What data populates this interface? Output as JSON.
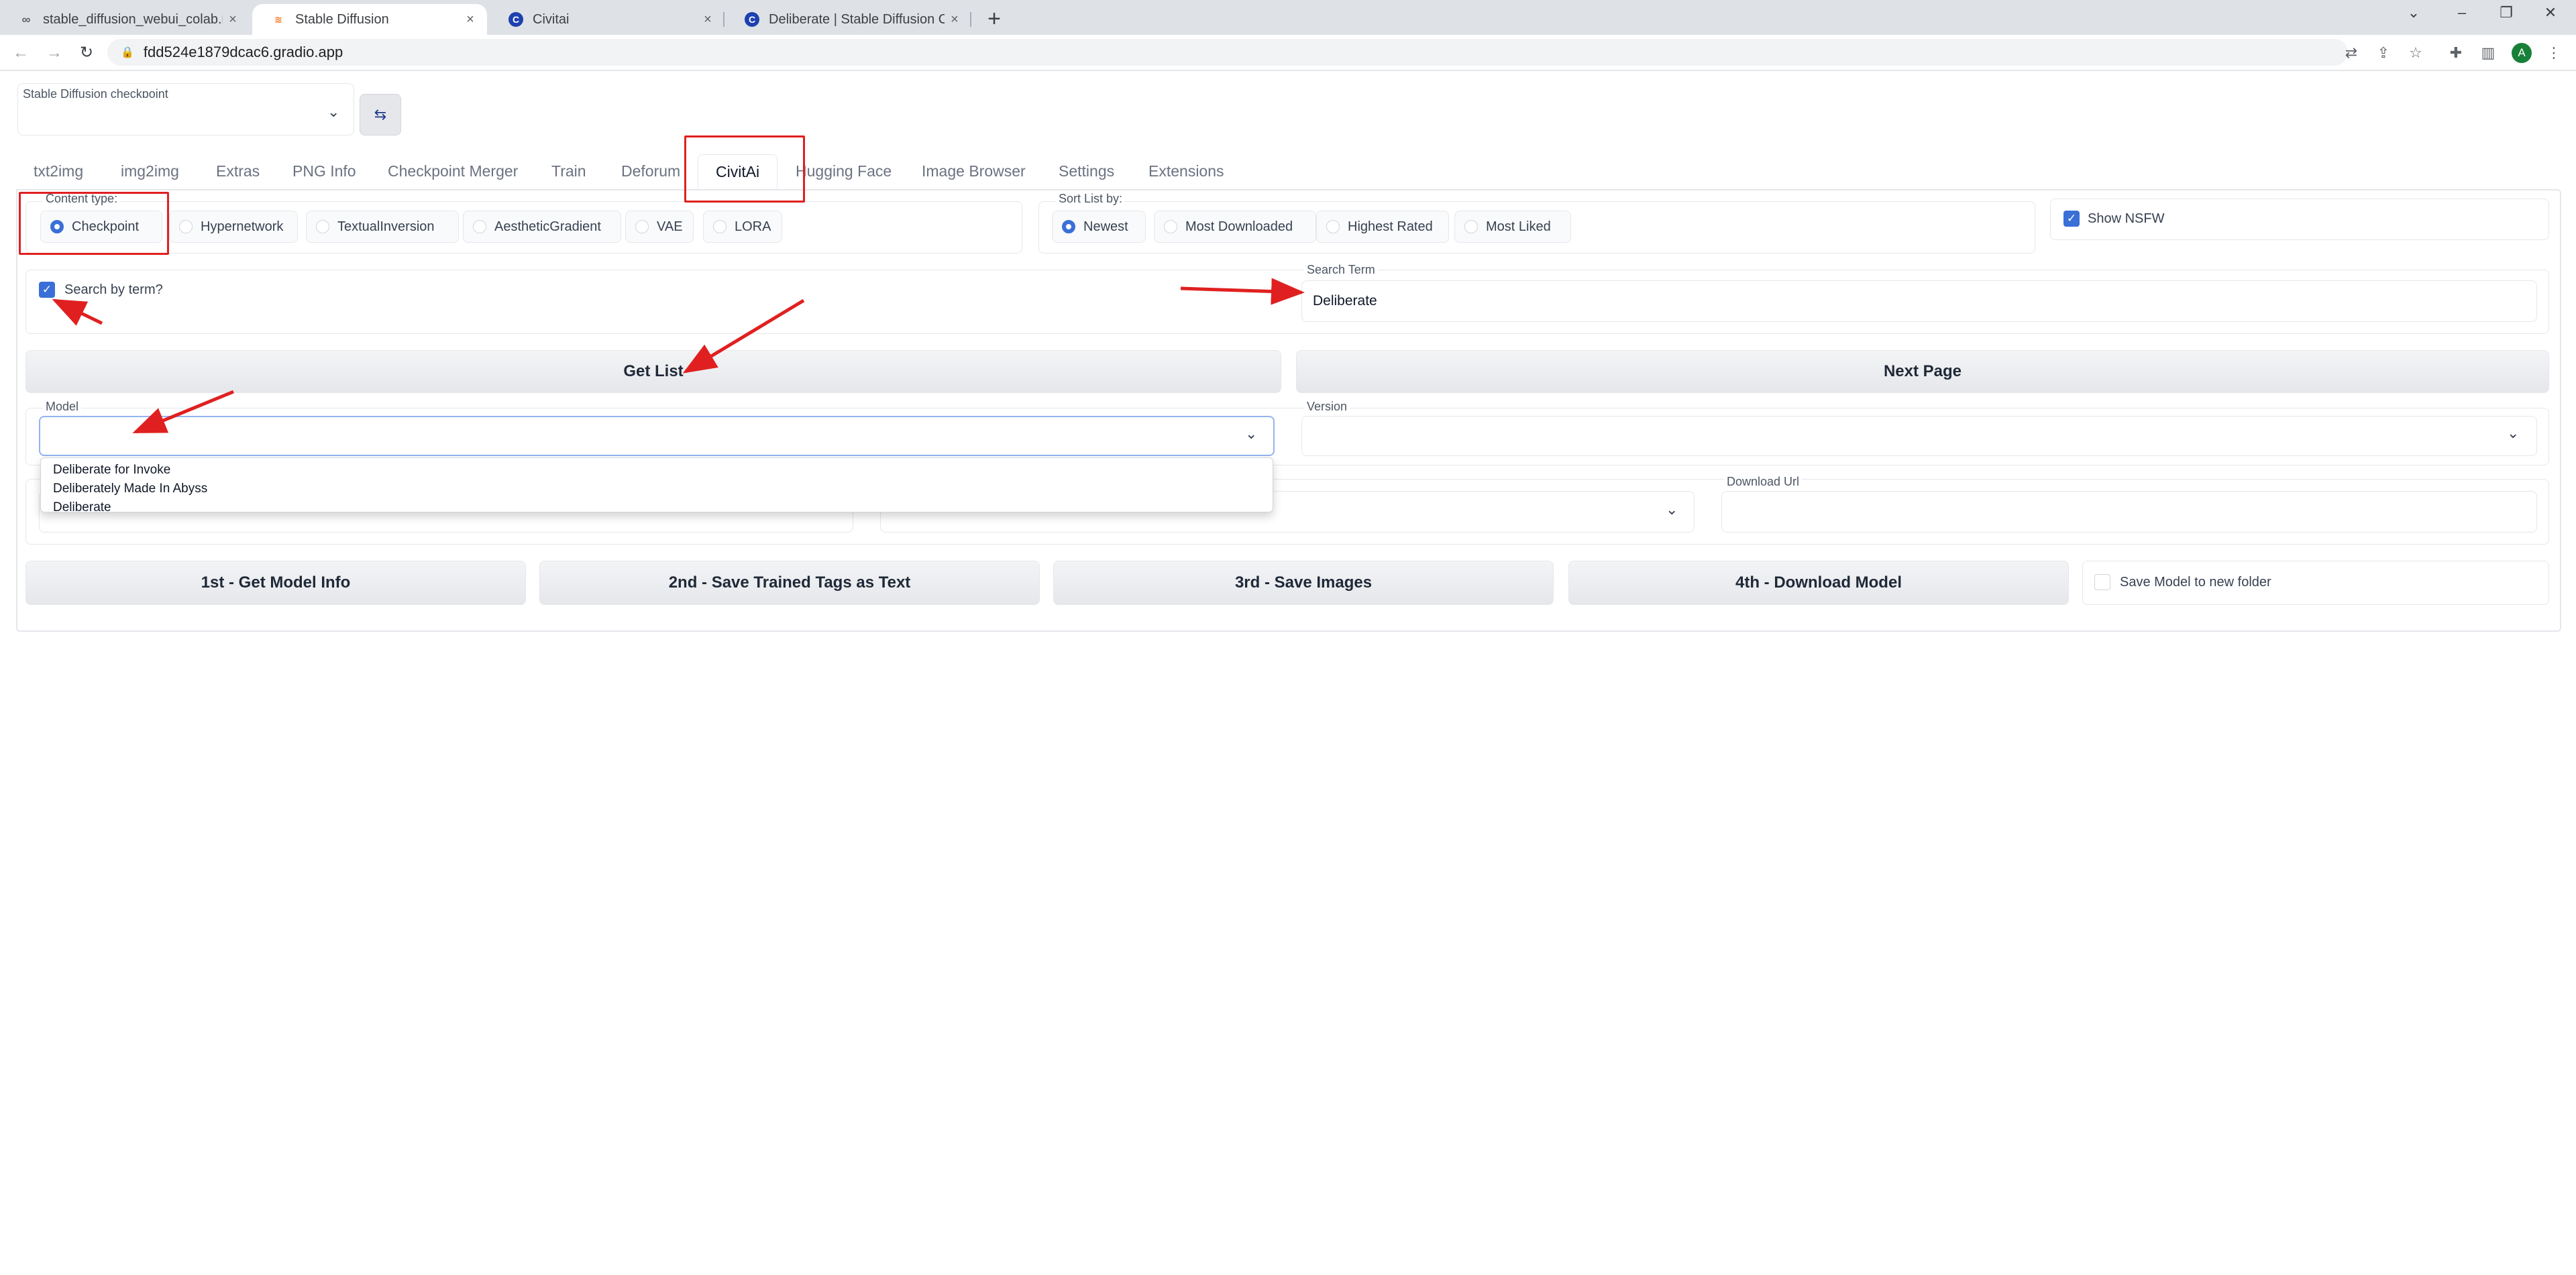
{
  "browser": {
    "tabs": [
      {
        "title": "stable_diffusion_webui_colab.i",
        "icon": "colab-icon"
      },
      {
        "title": "Stable Diffusion",
        "icon": "gradio-icon"
      },
      {
        "title": "Civitai",
        "icon": "civitai-icon"
      },
      {
        "title": "Deliberate | Stable Diffusion C",
        "icon": "civitai-icon"
      }
    ],
    "url": "fdd524e1879dcac6.gradio.app",
    "avatar_letter": "A"
  },
  "checkpoint": {
    "label": "Stable Diffusion checkpoint",
    "value": ""
  },
  "main_tabs": [
    "txt2img",
    "img2img",
    "Extras",
    "PNG Info",
    "Checkpoint Merger",
    "Train",
    "Deforum",
    "CivitAi",
    "Hugging Face",
    "Image Browser",
    "Settings",
    "Extensions"
  ],
  "active_tab": "CivitAi",
  "content_type": {
    "label": "Content type:",
    "options": [
      "Checkpoint",
      "Hypernetwork",
      "TextualInversion",
      "AestheticGradient",
      "VAE",
      "LORA"
    ],
    "selected": "Checkpoint"
  },
  "sort": {
    "label": "Sort List by:",
    "options": [
      "Newest",
      "Most Downloaded",
      "Highest Rated",
      "Most Liked"
    ],
    "selected": "Newest"
  },
  "show_nsfw": {
    "label": "Show NSFW",
    "checked": true
  },
  "search_by_term": {
    "label": "Search by term?",
    "checked": true
  },
  "search_term": {
    "label": "Search Term",
    "value": "Deliberate"
  },
  "buttons": {
    "get_list": "Get List",
    "next_page": "Next Page",
    "get_model_info": "1st - Get Model Info",
    "save_tags": "2nd - Save Trained Tags as Text",
    "save_images": "3rd - Save Images",
    "download_model": "4th - Download Model"
  },
  "model": {
    "label": "Model",
    "value": "",
    "options": [
      "Deliberate for Invoke",
      "Deliberately Made In Abyss",
      "Deliberate"
    ]
  },
  "version": {
    "label": "Version",
    "value": ""
  },
  "download_url": {
    "label": "Download Url",
    "value": ""
  },
  "save_new_folder": {
    "label": "Save Model to new folder",
    "checked": false
  },
  "colors": {
    "accent": "#3b6fd8",
    "annotation": "#e02020"
  }
}
